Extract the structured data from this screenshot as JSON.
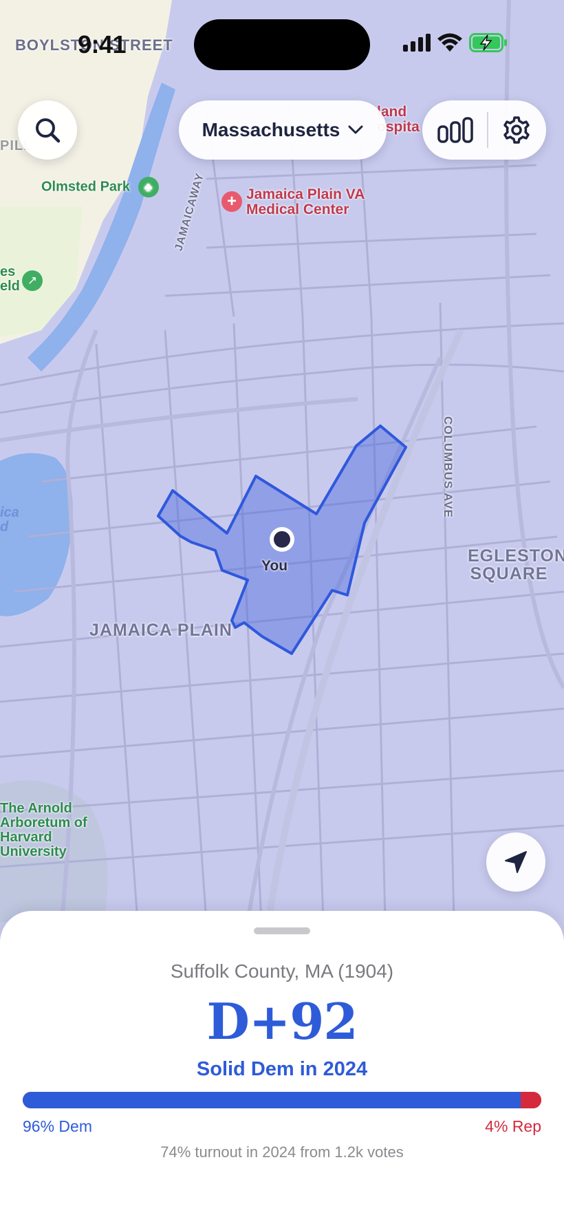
{
  "status_bar": {
    "time": "9:41",
    "icons": [
      "cellular-signal-icon",
      "wifi-icon",
      "battery-charging-icon"
    ]
  },
  "header": {
    "state_selector": "Massachusetts",
    "icons": [
      "search-icon",
      "chevron-down-icon",
      "bar-chart-icon",
      "gear-icon"
    ]
  },
  "map": {
    "streets": [
      "BOYLSTON STREET",
      "JAMAICAWAY",
      "COLUMBUS AVE"
    ],
    "neighborhoods": [
      "JAMAICA PLAIN",
      "EGLESTON SQUARE"
    ],
    "parks": [
      "Olmsted Park",
      "The Arnold Arboretum of Harvard University"
    ],
    "poi": [
      "Jamaica Plain VA Medical Center",
      "land ospita"
    ],
    "partial_labels": [
      "es",
      "eld",
      "PILL",
      "ica",
      "d"
    ],
    "user_marker_label": "You",
    "precinct_color": "#3d5fdf",
    "locate_icon": "location-arrow-icon"
  },
  "sheet": {
    "county": "Suffolk County, MA (1904)",
    "margin": "D+92",
    "rating": "Solid Dem in 2024",
    "dem_share": 0.96,
    "rep_share": 0.04,
    "dem_label": "96% Dem",
    "rep_label": "4% Rep",
    "turnout": "74% turnout in 2024 from 1.2k votes",
    "dem_color": "#2e5bd8",
    "rep_color": "#d52a3c"
  }
}
